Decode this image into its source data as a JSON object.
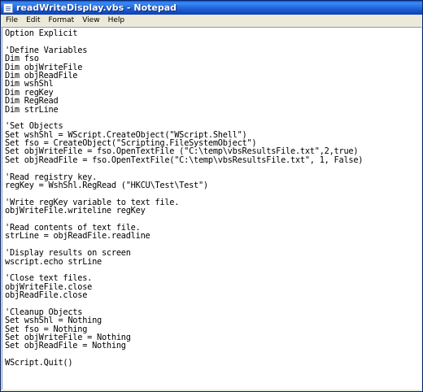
{
  "window": {
    "title": "readWriteDisplay.vbs - Notepad"
  },
  "menu": {
    "items": [
      "File",
      "Edit",
      "Format",
      "View",
      "Help"
    ]
  },
  "editor": {
    "lines": [
      "Option Explicit",
      "",
      "'Define Variables",
      "Dim fso",
      "Dim objWriteFile",
      "Dim objReadFile",
      "Dim wshShl",
      "Dim regKey",
      "Dim RegRead",
      "Dim strLine",
      "",
      "'Set Objects",
      "Set wshShl = WScript.CreateObject(\"WScript.Shell\")",
      "Set fso = CreateObject(\"Scripting.FileSystemObject\")",
      "Set objWriteFile = fso.OpenTextFile (\"C:\\temp\\vbsResultsFile.txt\",2,true)",
      "Set objReadFile = fso.OpenTextFile(\"C:\\temp\\vbsResultsFile.txt\", 1, False)",
      "",
      "'Read registry key.",
      "regKey = WshShl.RegRead (\"HKCU\\Test\\Test\")",
      "",
      "'Write regKey variable to text file.",
      "objWriteFile.writeline regKey",
      "",
      "'Read contents of text file.",
      "strLine = objReadFile.readline",
      "",
      "'Display results on screen",
      "wscript.echo strLine",
      "",
      "'Close text files.",
      "objWriteFile.close",
      "objReadFile.close",
      "",
      "'Cleanup Objects",
      "Set wshShl = Nothing",
      "Set fso = Nothing",
      "Set objWriteFile = Nothing",
      "Set objReadFile = Nothing",
      "",
      "WScript.Quit()"
    ]
  }
}
